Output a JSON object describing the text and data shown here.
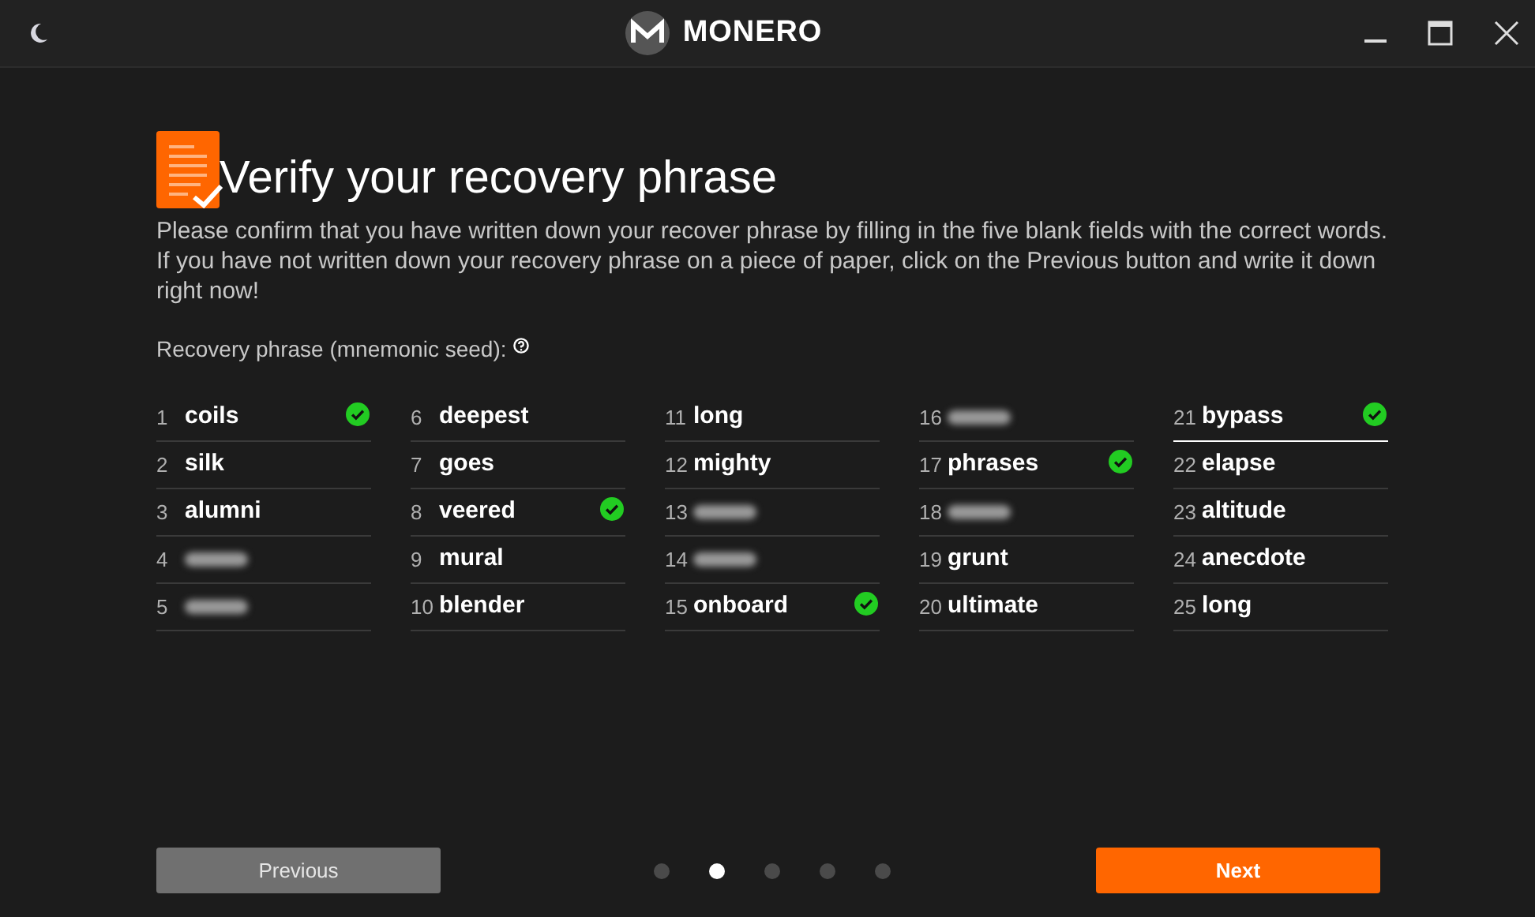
{
  "window": {
    "title": "MONERO"
  },
  "heading": "Verify your recovery phrase",
  "instructions": "Please confirm that you have written down your recover phrase by filling in the five blank fields with the correct words. If you have not written down your recovery phrase on a piece of paper, click on the Previous button and write it down right now!",
  "seed_label": "Recovery phrase (mnemonic seed):",
  "words": [
    {
      "number": "1",
      "kind": "word",
      "word": "coils",
      "checked": true,
      "focused": false
    },
    {
      "number": "2",
      "kind": "word",
      "word": "silk",
      "checked": false,
      "focused": false
    },
    {
      "number": "3",
      "kind": "word",
      "word": "alumni",
      "checked": false,
      "focused": false
    },
    {
      "number": "4",
      "kind": "redacted",
      "checked": false,
      "focused": false
    },
    {
      "number": "5",
      "kind": "redacted",
      "checked": false,
      "focused": false
    },
    {
      "number": "6",
      "kind": "word",
      "word": "deepest",
      "checked": false,
      "focused": false
    },
    {
      "number": "7",
      "kind": "word",
      "word": "goes",
      "checked": false,
      "focused": false
    },
    {
      "number": "8",
      "kind": "word",
      "word": "veered",
      "checked": true,
      "focused": false
    },
    {
      "number": "9",
      "kind": "word",
      "word": "mural",
      "checked": false,
      "focused": false
    },
    {
      "number": "10",
      "kind": "word",
      "word": "blender",
      "checked": false,
      "focused": false
    },
    {
      "number": "11",
      "kind": "word",
      "word": "long",
      "checked": false,
      "focused": false
    },
    {
      "number": "12",
      "kind": "word",
      "word": "mighty",
      "checked": false,
      "focused": false
    },
    {
      "number": "13",
      "kind": "redacted",
      "checked": false,
      "focused": false
    },
    {
      "number": "14",
      "kind": "redacted",
      "checked": false,
      "focused": false
    },
    {
      "number": "15",
      "kind": "word",
      "word": "onboard",
      "checked": true,
      "focused": false
    },
    {
      "number": "16",
      "kind": "redacted",
      "checked": false,
      "focused": false
    },
    {
      "number": "17",
      "kind": "word",
      "word": "phrases",
      "checked": true,
      "focused": false
    },
    {
      "number": "18",
      "kind": "redacted",
      "checked": false,
      "focused": false
    },
    {
      "number": "19",
      "kind": "word",
      "word": "grunt",
      "checked": false,
      "focused": false
    },
    {
      "number": "20",
      "kind": "word",
      "word": "ultimate",
      "checked": false,
      "focused": false
    },
    {
      "number": "21",
      "kind": "word",
      "word": "bypass",
      "checked": true,
      "focused": true
    },
    {
      "number": "22",
      "kind": "word",
      "word": "elapse",
      "checked": false,
      "focused": false
    },
    {
      "number": "23",
      "kind": "word",
      "word": "altitude",
      "checked": false,
      "focused": false
    },
    {
      "number": "24",
      "kind": "word",
      "word": "anecdote",
      "checked": false,
      "focused": false
    },
    {
      "number": "25",
      "kind": "word",
      "word": "long",
      "checked": false,
      "focused": false
    }
  ],
  "previous_button": "Previous",
  "next_button": "Next",
  "pages": [
    {
      "selected": false
    },
    {
      "selected": true
    },
    {
      "selected": false
    },
    {
      "selected": false
    },
    {
      "selected": false
    }
  ]
}
